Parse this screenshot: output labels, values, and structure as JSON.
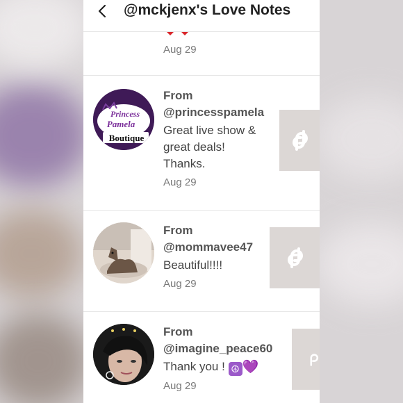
{
  "header": {
    "title": "@mckjenx's Love Notes"
  },
  "top_note": {
    "date": "Aug 29"
  },
  "notes": [
    {
      "from_label": "From",
      "handle": "@princesspamela",
      "message_lines": [
        "Great live show &",
        "great deals!",
        "Thanks."
      ],
      "date": "Aug 29",
      "avatar_text": {
        "line1": "Princess",
        "line2": "Pamela",
        "line3": "Boutique"
      }
    },
    {
      "from_label": "From",
      "handle": "@mommavee47",
      "message_lines": [
        "Beautiful!!!!"
      ],
      "date": "Aug 29"
    },
    {
      "from_label": "From",
      "handle": "@imagine_peace60",
      "message": "Thank you !",
      "peace_emoji": "☮",
      "heart_emoji": "💜",
      "date": "Aug 29"
    }
  ],
  "colors": {
    "brand_purple": "#4b1d5e",
    "text_gray": "#555555",
    "thumb_bg": "#dcd7d5"
  }
}
